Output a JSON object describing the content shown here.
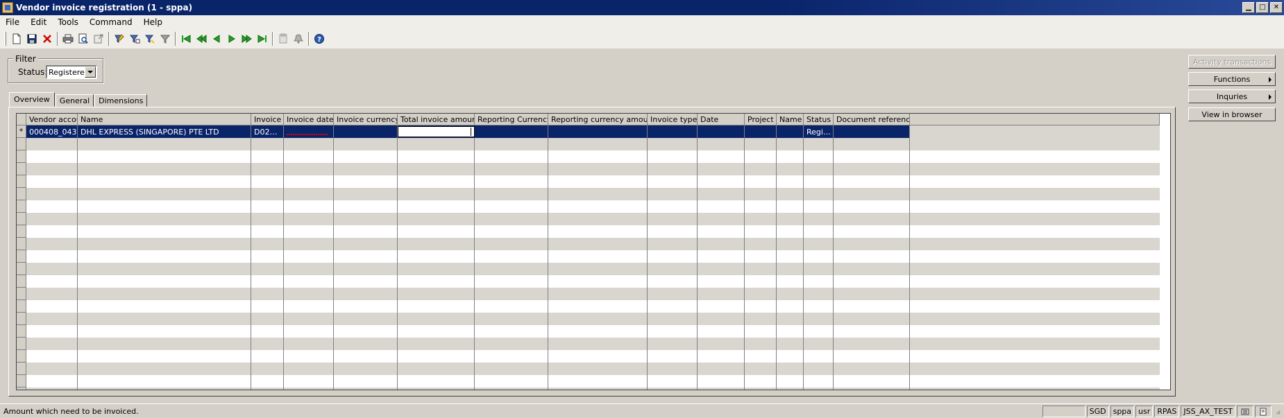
{
  "window": {
    "title": "Vendor invoice registration (1 - sppa)",
    "controls": [
      "minimize",
      "maximize",
      "close"
    ]
  },
  "menu": [
    "File",
    "Edit",
    "Tools",
    "Command",
    "Help"
  ],
  "toolbar": {
    "icons": [
      "new-document-icon",
      "save-icon",
      "delete-icon",
      "print-icon",
      "print-preview-icon",
      "export-icon",
      "filter-by-selection-icon",
      "advanced-filter-icon",
      "filter-by-field-icon",
      "remove-filter-icon",
      "first-record-icon",
      "previous-page-icon",
      "previous-record-icon",
      "next-record-icon",
      "next-page-icon",
      "last-record-icon",
      "attachments-icon",
      "alerts-icon",
      "help-icon"
    ]
  },
  "filter": {
    "legend": "Filter",
    "status_label": "Status:",
    "status_value": "Registered"
  },
  "tabs": [
    "Overview",
    "General",
    "Dimensions"
  ],
  "active_tab": "Overview",
  "grid": {
    "columns": [
      "Vendor account",
      "Name",
      "Invoice",
      "Invoice date",
      "Invoice currency",
      "Total invoice amount",
      "Reporting Currency",
      "Reporting currency amount",
      "Invoice type",
      "Date",
      "Project",
      "Name",
      "Status",
      "Document reference"
    ],
    "rows": [
      {
        "vendor_account": "000408_043",
        "name": "DHL EXPRESS (SINGAPORE) PTE LTD",
        "invoice": "D02…",
        "invoice_date": "",
        "invoice_currency": "",
        "total_invoice_amount": "",
        "reporting_currency": "",
        "reporting_currency_amount": "",
        "invoice_type": "",
        "date": "",
        "project": "",
        "name2": "",
        "status": "Regi…",
        "document_reference": ""
      }
    ],
    "new_row_marker": "*"
  },
  "side_buttons": [
    {
      "label": "Activity transactions",
      "enabled": false,
      "submenu": false
    },
    {
      "label": "Functions",
      "enabled": true,
      "submenu": true
    },
    {
      "label": "Inquries",
      "enabled": true,
      "submenu": true
    },
    {
      "label": "View in browser",
      "enabled": true,
      "submenu": false
    }
  ],
  "statusbar": {
    "message": "Amount which need to be invoiced.",
    "cells": [
      "SGD",
      "sppa",
      "usr",
      "RPAS",
      "JSS_AX_TEST"
    ]
  },
  "colors": {
    "titlebar": "#0a246a",
    "selection": "#0a246a",
    "face": "#d4d0c8",
    "alt_row": "#d9d6d0"
  }
}
